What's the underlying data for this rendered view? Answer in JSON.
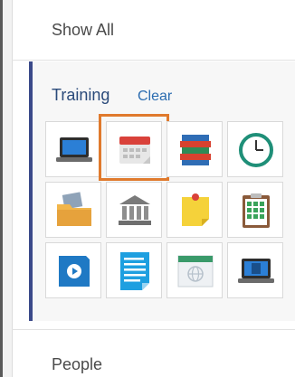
{
  "header": {
    "show_all_label": "Show All"
  },
  "section": {
    "title": "Training",
    "clear_label": "Clear",
    "tiles": [
      {
        "icon": "laptop-icon"
      },
      {
        "icon": "calendar-icon",
        "selected": true
      },
      {
        "icon": "books-icon"
      },
      {
        "icon": "clock-icon"
      },
      {
        "icon": "folder-photos-icon"
      },
      {
        "icon": "bank-icon"
      },
      {
        "icon": "sticky-note-icon"
      },
      {
        "icon": "clipboard-checklist-icon"
      },
      {
        "icon": "video-play-icon"
      },
      {
        "icon": "document-icon"
      },
      {
        "icon": "web-window-icon"
      },
      {
        "icon": "laptop-calculator-icon"
      }
    ]
  },
  "footer": {
    "people_label": "People"
  },
  "colors": {
    "accent_bar": "#3b4a8a",
    "selection": "#e07a2d",
    "link": "#2b6cb0"
  }
}
